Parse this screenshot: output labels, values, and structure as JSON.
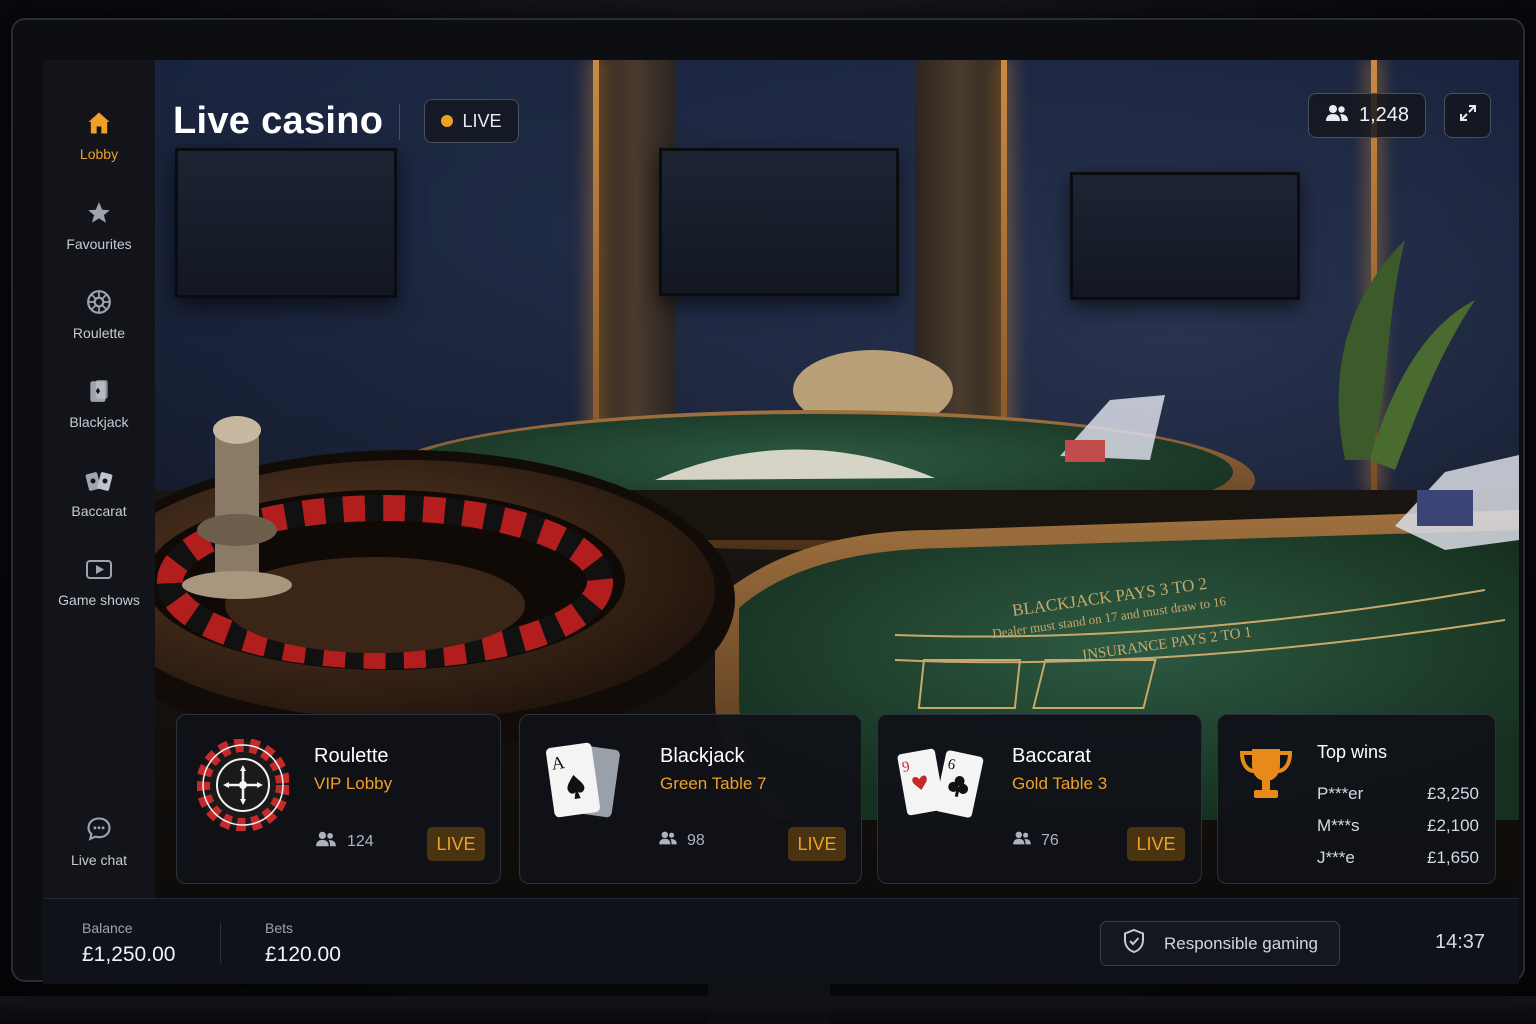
{
  "sidebar": {
    "items": [
      {
        "label": "Lobby",
        "icon": "home-icon",
        "active": true
      },
      {
        "label": "Favourites",
        "icon": "star-icon"
      },
      {
        "label": "Roulette",
        "icon": "roulette-icon"
      },
      {
        "label": "Blackjack",
        "icon": "playing-card-icon"
      },
      {
        "label": "Baccarat",
        "icon": "cards-fan-icon"
      },
      {
        "label": "Game shows",
        "icon": "video-play-icon"
      }
    ],
    "live_chat": {
      "label": "Live chat",
      "icon": "chat-bubble-icon"
    }
  },
  "header": {
    "title": "Live casino",
    "live_label": "LIVE",
    "viewers": "1,248",
    "expand_icon": "expand-icon"
  },
  "cards": [
    {
      "game": "Roulette",
      "table": "VIP Lobby",
      "players": "124",
      "badge": "LIVE",
      "icon": "roulette-wheel-icon"
    },
    {
      "game": "Blackjack",
      "table": "Green Table 7",
      "players": "98",
      "badge": "LIVE",
      "icon": "ace-of-spades-icon"
    },
    {
      "game": "Baccarat",
      "table": "Gold Table 3",
      "players": "76",
      "badge": "LIVE",
      "icon": "baccarat-cards-icon"
    }
  ],
  "top_wins": {
    "title": "Top wins",
    "icon": "trophy-icon",
    "rows": [
      {
        "player": "P***er",
        "amount": "£3,250"
      },
      {
        "player": "M***s",
        "amount": "£2,100"
      },
      {
        "player": "J***e",
        "amount": "£1,650"
      }
    ]
  },
  "scene_text": {
    "line1": "BLACKJACK PAYS 3 TO 2",
    "line2": "Dealer must stand on 17 and must draw to 16",
    "line3": "INSURANCE PAYS 2 TO 1"
  },
  "footer": {
    "balance_label": "Balance",
    "balance_value": "£1,250.00",
    "bets_label": "Bets",
    "bets_value": "£120.00",
    "responsible_label": "Responsible gaming",
    "clock": "14:37"
  },
  "colors": {
    "accent": "#f0a024",
    "background": "#0c0e14",
    "card": "#101218",
    "felt": "#1f3a2c"
  }
}
